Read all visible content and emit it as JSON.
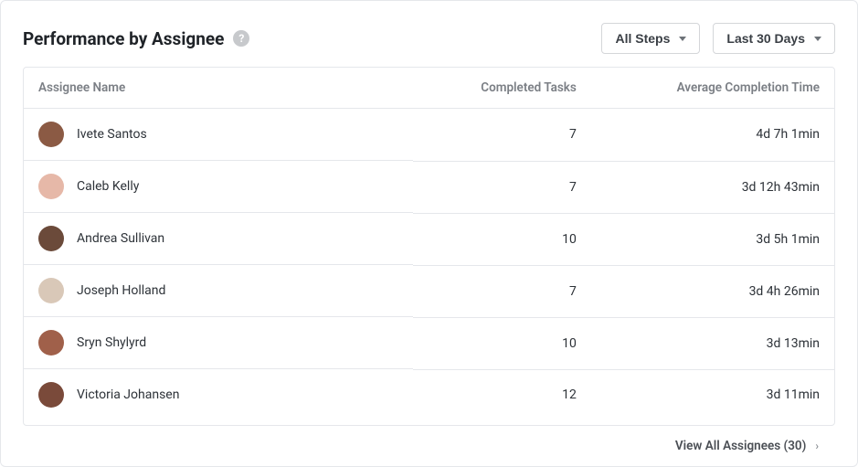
{
  "header": {
    "title": "Performance by Assignee",
    "help": "?"
  },
  "filters": {
    "steps_label": "All Steps",
    "range_label": "Last 30 Days"
  },
  "columns": {
    "name": "Assignee Name",
    "tasks": "Completed Tasks",
    "time": "Average Completion Time"
  },
  "rows": [
    {
      "name": "Ivete Santos",
      "tasks": "7",
      "time": "4d 7h 1min",
      "avatarBg": "#8b5a44"
    },
    {
      "name": "Caleb Kelly",
      "tasks": "7",
      "time": "3d 12h 43min",
      "avatarBg": "#e6b8a8"
    },
    {
      "name": "Andrea Sullivan",
      "tasks": "10",
      "time": "3d 5h 1min",
      "avatarBg": "#6b4a3a"
    },
    {
      "name": "Joseph Holland",
      "tasks": "7",
      "time": "3d 4h 26min",
      "avatarBg": "#d9c8b8"
    },
    {
      "name": "Sryn Shylyrd",
      "tasks": "10",
      "time": "3d 13min",
      "avatarBg": "#a0604a"
    },
    {
      "name": "Victoria Johansen",
      "tasks": "12",
      "time": "3d 11min",
      "avatarBg": "#7a4a3a"
    }
  ],
  "footer": {
    "view_all": "View All Assignees (30)"
  }
}
